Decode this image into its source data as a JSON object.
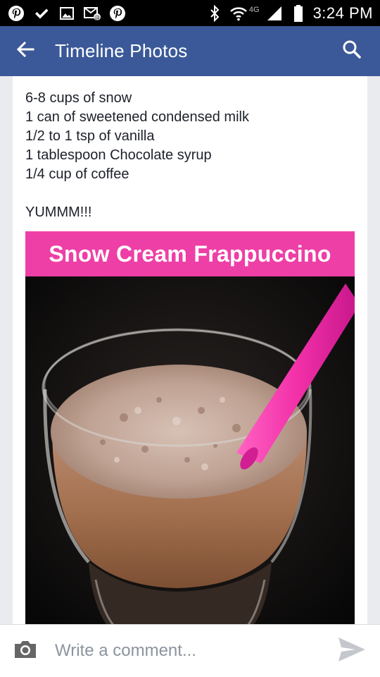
{
  "status_bar": {
    "time": "3:24 PM",
    "network": "4G",
    "icons": [
      "pinterest-icon",
      "check-icon",
      "gallery-icon",
      "messages-icon",
      "pinterest-icon",
      "bluetooth-icon",
      "wifi-icon",
      "signal-icon",
      "battery-icon"
    ]
  },
  "app_bar": {
    "title": "Timeline Photos",
    "back_icon": "arrow-left-icon",
    "search_icon": "search-icon",
    "color": "#3b5998"
  },
  "post": {
    "lines": [
      "6-8 cups of snow",
      "1 can of sweetened condensed milk",
      "1/2 to 1 tsp of vanilla",
      "1 tablespoon Chocolate syrup",
      "1/4 cup of coffee"
    ],
    "exclamation": "YUMMM!!!"
  },
  "photo": {
    "banner_text": "Snow Cream Frappuccino",
    "banner_color": "#ee3fa6",
    "straw_color": "#f22fa8"
  },
  "comment_bar": {
    "placeholder": "Write a comment...",
    "camera_icon": "camera-icon",
    "send_icon": "send-icon"
  }
}
